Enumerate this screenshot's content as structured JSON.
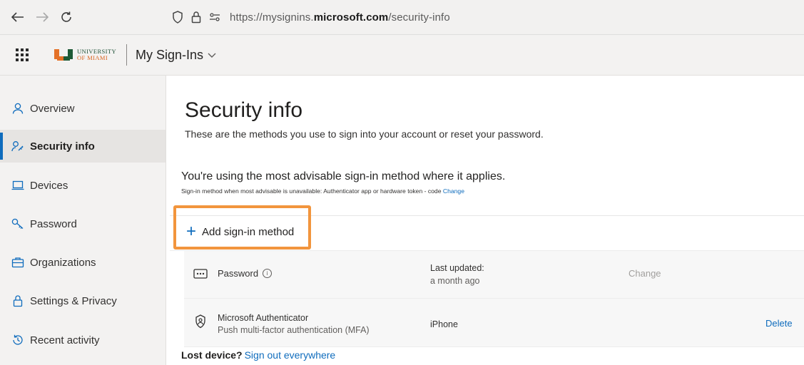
{
  "browser": {
    "url_prefix": "https://mysignins.",
    "url_domain": "microsoft.com",
    "url_path": "/security-info"
  },
  "header": {
    "logo_line1": "UNIVERSITY",
    "logo_line2": "OF MIAMI",
    "app_title": "My Sign-Ins"
  },
  "sidebar": {
    "items": [
      {
        "label": "Overview",
        "icon": "person-icon"
      },
      {
        "label": "Security info",
        "icon": "key-person-icon"
      },
      {
        "label": "Devices",
        "icon": "laptop-icon"
      },
      {
        "label": "Password",
        "icon": "key-icon"
      },
      {
        "label": "Organizations",
        "icon": "briefcase-icon"
      },
      {
        "label": "Settings & Privacy",
        "icon": "lock-icon"
      },
      {
        "label": "Recent activity",
        "icon": "history-icon"
      }
    ]
  },
  "main": {
    "title": "Security info",
    "subtitle": "These are the methods you use to sign into your account or reset your password.",
    "advisable_title": "You're using the most advisable sign-in method where it applies.",
    "advisable_sub": "Sign-in method when most advisable is unavailable: Authenticator app or hardware token - code",
    "advisable_change": "Change",
    "add_method_label": "Add sign-in method",
    "methods": [
      {
        "name": "Password",
        "detail_label": "Last updated:",
        "detail_value": "a month ago",
        "action": "Change"
      },
      {
        "name": "Microsoft Authenticator",
        "subname": "Push multi-factor authentication (MFA)",
        "detail_value": "iPhone",
        "action": "Delete"
      }
    ],
    "lost_device": "Lost device?",
    "sign_out_everywhere": "Sign out everywhere"
  },
  "colors": {
    "accent": "#0f6cbd",
    "highlight": "#f2953d",
    "sidebar_bg": "#f3f2f1"
  }
}
